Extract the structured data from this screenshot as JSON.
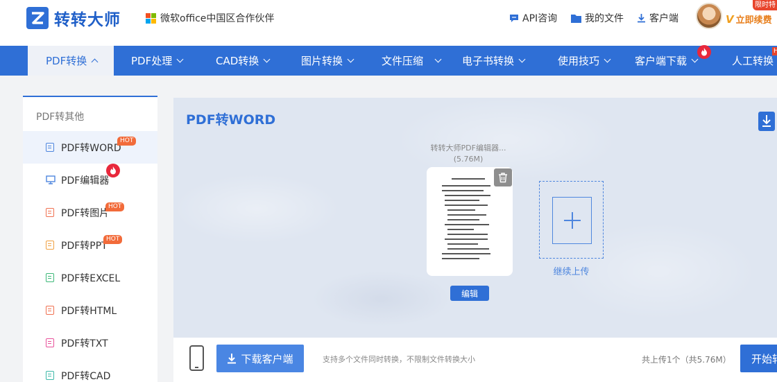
{
  "header": {
    "brand": "转转大师",
    "partner": "微软office中国区合作伙伴",
    "links": [
      {
        "label": "API咨询",
        "icon": "chat-icon"
      },
      {
        "label": "我的文件",
        "icon": "folder-icon"
      },
      {
        "label": "客户端",
        "icon": "download-icon"
      }
    ],
    "vip_label": "立即续费",
    "vip_mark": "V",
    "limited_label": "限时特"
  },
  "nav": {
    "items": [
      {
        "label": "PDF转换"
      },
      {
        "label": "PDF处理"
      },
      {
        "label": "CAD转换"
      },
      {
        "label": "图片转换"
      },
      {
        "label": "文件压缩"
      },
      {
        "label": "电子书转换"
      },
      {
        "label": "使用技巧"
      },
      {
        "label": "客户端下载"
      },
      {
        "label": "人工转换"
      }
    ],
    "hot_h": "H"
  },
  "sidebar": {
    "title": "PDF转其他",
    "items": [
      {
        "label": "PDF转WORD",
        "badge": "HOT"
      },
      {
        "label": "PDF编辑器"
      },
      {
        "label": "PDF转图片",
        "badge": "HOT"
      },
      {
        "label": "PDF转PPT",
        "badge": "HOT"
      },
      {
        "label": "PDF转EXCEL"
      },
      {
        "label": "PDF转HTML"
      },
      {
        "label": "PDF转TXT"
      },
      {
        "label": "PDF转CAD"
      }
    ]
  },
  "main": {
    "title": "PDF转WORD",
    "file": {
      "name": "转转大师PDF编辑器...",
      "size": "(5.76M)"
    },
    "edit_label": "编辑",
    "upload_label": "继续上传"
  },
  "bottom": {
    "download_label": "下载客户端",
    "support_text": "支持多个文件同时转换，不限制文件转换大小",
    "total_text": "共上传1个（共5.76M）",
    "start_label": "开始转"
  },
  "colors": {
    "primary": "#2f6fd6",
    "hot": "#f26b3a",
    "fire": "#e8283c"
  }
}
